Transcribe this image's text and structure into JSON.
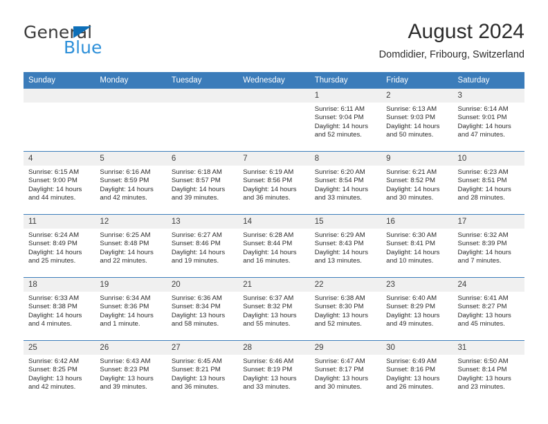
{
  "brand": {
    "name_part1": "General",
    "name_part2": "Blue",
    "triangle_color": "#0d6fb8",
    "blue_color": "#2e90d9"
  },
  "header": {
    "title": "August 2024",
    "subtitle": "Domdidier, Fribourg, Switzerland",
    "accent_color": "#3b7cba"
  },
  "weekday_headers": [
    "Sunday",
    "Monday",
    "Tuesday",
    "Wednesday",
    "Thursday",
    "Friday",
    "Saturday"
  ],
  "labels": {
    "sunrise": "Sunrise:",
    "sunset": "Sunset:",
    "daylight": "Daylight:"
  },
  "weeks": [
    [
      {
        "day": "",
        "blank": true
      },
      {
        "day": "",
        "blank": true
      },
      {
        "day": "",
        "blank": true
      },
      {
        "day": "",
        "blank": true
      },
      {
        "day": "1",
        "sunrise": "Sunrise: 6:11 AM",
        "sunset": "Sunset: 9:04 PM",
        "daylight_line1": "Daylight: 14 hours",
        "daylight_line2": "and 52 minutes."
      },
      {
        "day": "2",
        "sunrise": "Sunrise: 6:13 AM",
        "sunset": "Sunset: 9:03 PM",
        "daylight_line1": "Daylight: 14 hours",
        "daylight_line2": "and 50 minutes."
      },
      {
        "day": "3",
        "sunrise": "Sunrise: 6:14 AM",
        "sunset": "Sunset: 9:01 PM",
        "daylight_line1": "Daylight: 14 hours",
        "daylight_line2": "and 47 minutes."
      }
    ],
    [
      {
        "day": "4",
        "sunrise": "Sunrise: 6:15 AM",
        "sunset": "Sunset: 9:00 PM",
        "daylight_line1": "Daylight: 14 hours",
        "daylight_line2": "and 44 minutes."
      },
      {
        "day": "5",
        "sunrise": "Sunrise: 6:16 AM",
        "sunset": "Sunset: 8:59 PM",
        "daylight_line1": "Daylight: 14 hours",
        "daylight_line2": "and 42 minutes."
      },
      {
        "day": "6",
        "sunrise": "Sunrise: 6:18 AM",
        "sunset": "Sunset: 8:57 PM",
        "daylight_line1": "Daylight: 14 hours",
        "daylight_line2": "and 39 minutes."
      },
      {
        "day": "7",
        "sunrise": "Sunrise: 6:19 AM",
        "sunset": "Sunset: 8:56 PM",
        "daylight_line1": "Daylight: 14 hours",
        "daylight_line2": "and 36 minutes."
      },
      {
        "day": "8",
        "sunrise": "Sunrise: 6:20 AM",
        "sunset": "Sunset: 8:54 PM",
        "daylight_line1": "Daylight: 14 hours",
        "daylight_line2": "and 33 minutes."
      },
      {
        "day": "9",
        "sunrise": "Sunrise: 6:21 AM",
        "sunset": "Sunset: 8:52 PM",
        "daylight_line1": "Daylight: 14 hours",
        "daylight_line2": "and 30 minutes."
      },
      {
        "day": "10",
        "sunrise": "Sunrise: 6:23 AM",
        "sunset": "Sunset: 8:51 PM",
        "daylight_line1": "Daylight: 14 hours",
        "daylight_line2": "and 28 minutes."
      }
    ],
    [
      {
        "day": "11",
        "sunrise": "Sunrise: 6:24 AM",
        "sunset": "Sunset: 8:49 PM",
        "daylight_line1": "Daylight: 14 hours",
        "daylight_line2": "and 25 minutes."
      },
      {
        "day": "12",
        "sunrise": "Sunrise: 6:25 AM",
        "sunset": "Sunset: 8:48 PM",
        "daylight_line1": "Daylight: 14 hours",
        "daylight_line2": "and 22 minutes."
      },
      {
        "day": "13",
        "sunrise": "Sunrise: 6:27 AM",
        "sunset": "Sunset: 8:46 PM",
        "daylight_line1": "Daylight: 14 hours",
        "daylight_line2": "and 19 minutes."
      },
      {
        "day": "14",
        "sunrise": "Sunrise: 6:28 AM",
        "sunset": "Sunset: 8:44 PM",
        "daylight_line1": "Daylight: 14 hours",
        "daylight_line2": "and 16 minutes."
      },
      {
        "day": "15",
        "sunrise": "Sunrise: 6:29 AM",
        "sunset": "Sunset: 8:43 PM",
        "daylight_line1": "Daylight: 14 hours",
        "daylight_line2": "and 13 minutes."
      },
      {
        "day": "16",
        "sunrise": "Sunrise: 6:30 AM",
        "sunset": "Sunset: 8:41 PM",
        "daylight_line1": "Daylight: 14 hours",
        "daylight_line2": "and 10 minutes."
      },
      {
        "day": "17",
        "sunrise": "Sunrise: 6:32 AM",
        "sunset": "Sunset: 8:39 PM",
        "daylight_line1": "Daylight: 14 hours",
        "daylight_line2": "and 7 minutes."
      }
    ],
    [
      {
        "day": "18",
        "sunrise": "Sunrise: 6:33 AM",
        "sunset": "Sunset: 8:38 PM",
        "daylight_line1": "Daylight: 14 hours",
        "daylight_line2": "and 4 minutes."
      },
      {
        "day": "19",
        "sunrise": "Sunrise: 6:34 AM",
        "sunset": "Sunset: 8:36 PM",
        "daylight_line1": "Daylight: 14 hours",
        "daylight_line2": "and 1 minute."
      },
      {
        "day": "20",
        "sunrise": "Sunrise: 6:36 AM",
        "sunset": "Sunset: 8:34 PM",
        "daylight_line1": "Daylight: 13 hours",
        "daylight_line2": "and 58 minutes."
      },
      {
        "day": "21",
        "sunrise": "Sunrise: 6:37 AM",
        "sunset": "Sunset: 8:32 PM",
        "daylight_line1": "Daylight: 13 hours",
        "daylight_line2": "and 55 minutes."
      },
      {
        "day": "22",
        "sunrise": "Sunrise: 6:38 AM",
        "sunset": "Sunset: 8:30 PM",
        "daylight_line1": "Daylight: 13 hours",
        "daylight_line2": "and 52 minutes."
      },
      {
        "day": "23",
        "sunrise": "Sunrise: 6:40 AM",
        "sunset": "Sunset: 8:29 PM",
        "daylight_line1": "Daylight: 13 hours",
        "daylight_line2": "and 49 minutes."
      },
      {
        "day": "24",
        "sunrise": "Sunrise: 6:41 AM",
        "sunset": "Sunset: 8:27 PM",
        "daylight_line1": "Daylight: 13 hours",
        "daylight_line2": "and 45 minutes."
      }
    ],
    [
      {
        "day": "25",
        "sunrise": "Sunrise: 6:42 AM",
        "sunset": "Sunset: 8:25 PM",
        "daylight_line1": "Daylight: 13 hours",
        "daylight_line2": "and 42 minutes."
      },
      {
        "day": "26",
        "sunrise": "Sunrise: 6:43 AM",
        "sunset": "Sunset: 8:23 PM",
        "daylight_line1": "Daylight: 13 hours",
        "daylight_line2": "and 39 minutes."
      },
      {
        "day": "27",
        "sunrise": "Sunrise: 6:45 AM",
        "sunset": "Sunset: 8:21 PM",
        "daylight_line1": "Daylight: 13 hours",
        "daylight_line2": "and 36 minutes."
      },
      {
        "day": "28",
        "sunrise": "Sunrise: 6:46 AM",
        "sunset": "Sunset: 8:19 PM",
        "daylight_line1": "Daylight: 13 hours",
        "daylight_line2": "and 33 minutes."
      },
      {
        "day": "29",
        "sunrise": "Sunrise: 6:47 AM",
        "sunset": "Sunset: 8:17 PM",
        "daylight_line1": "Daylight: 13 hours",
        "daylight_line2": "and 30 minutes."
      },
      {
        "day": "30",
        "sunrise": "Sunrise: 6:49 AM",
        "sunset": "Sunset: 8:16 PM",
        "daylight_line1": "Daylight: 13 hours",
        "daylight_line2": "and 26 minutes."
      },
      {
        "day": "31",
        "sunrise": "Sunrise: 6:50 AM",
        "sunset": "Sunset: 8:14 PM",
        "daylight_line1": "Daylight: 13 hours",
        "daylight_line2": "and 23 minutes."
      }
    ]
  ]
}
